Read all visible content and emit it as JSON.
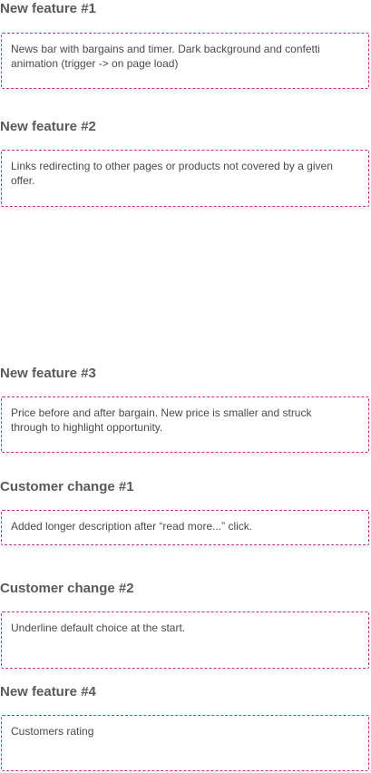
{
  "sections": [
    {
      "heading": "New feature #1",
      "text": "News bar with bargains and timer. Dark background and confetti animation (trigger -> on page load)"
    },
    {
      "heading": "New feature #2",
      "text": "Links redirecting to other pages or products not covered by a given offer."
    },
    {
      "heading": "New feature #3",
      "text": "Price before and after bargain. New price is smaller and struck through to highlight opportunity."
    },
    {
      "heading": "Customer change #1",
      "text": "Added longer description after “read more...” click."
    },
    {
      "heading": "Customer change #2",
      "text": "Underline default choice at the start."
    },
    {
      "heading": "New feature #4",
      "text": "Customers rating"
    }
  ],
  "colors": {
    "heading": "#5a5a5a",
    "border": "#c2308c",
    "text": "#4a4a4a"
  }
}
